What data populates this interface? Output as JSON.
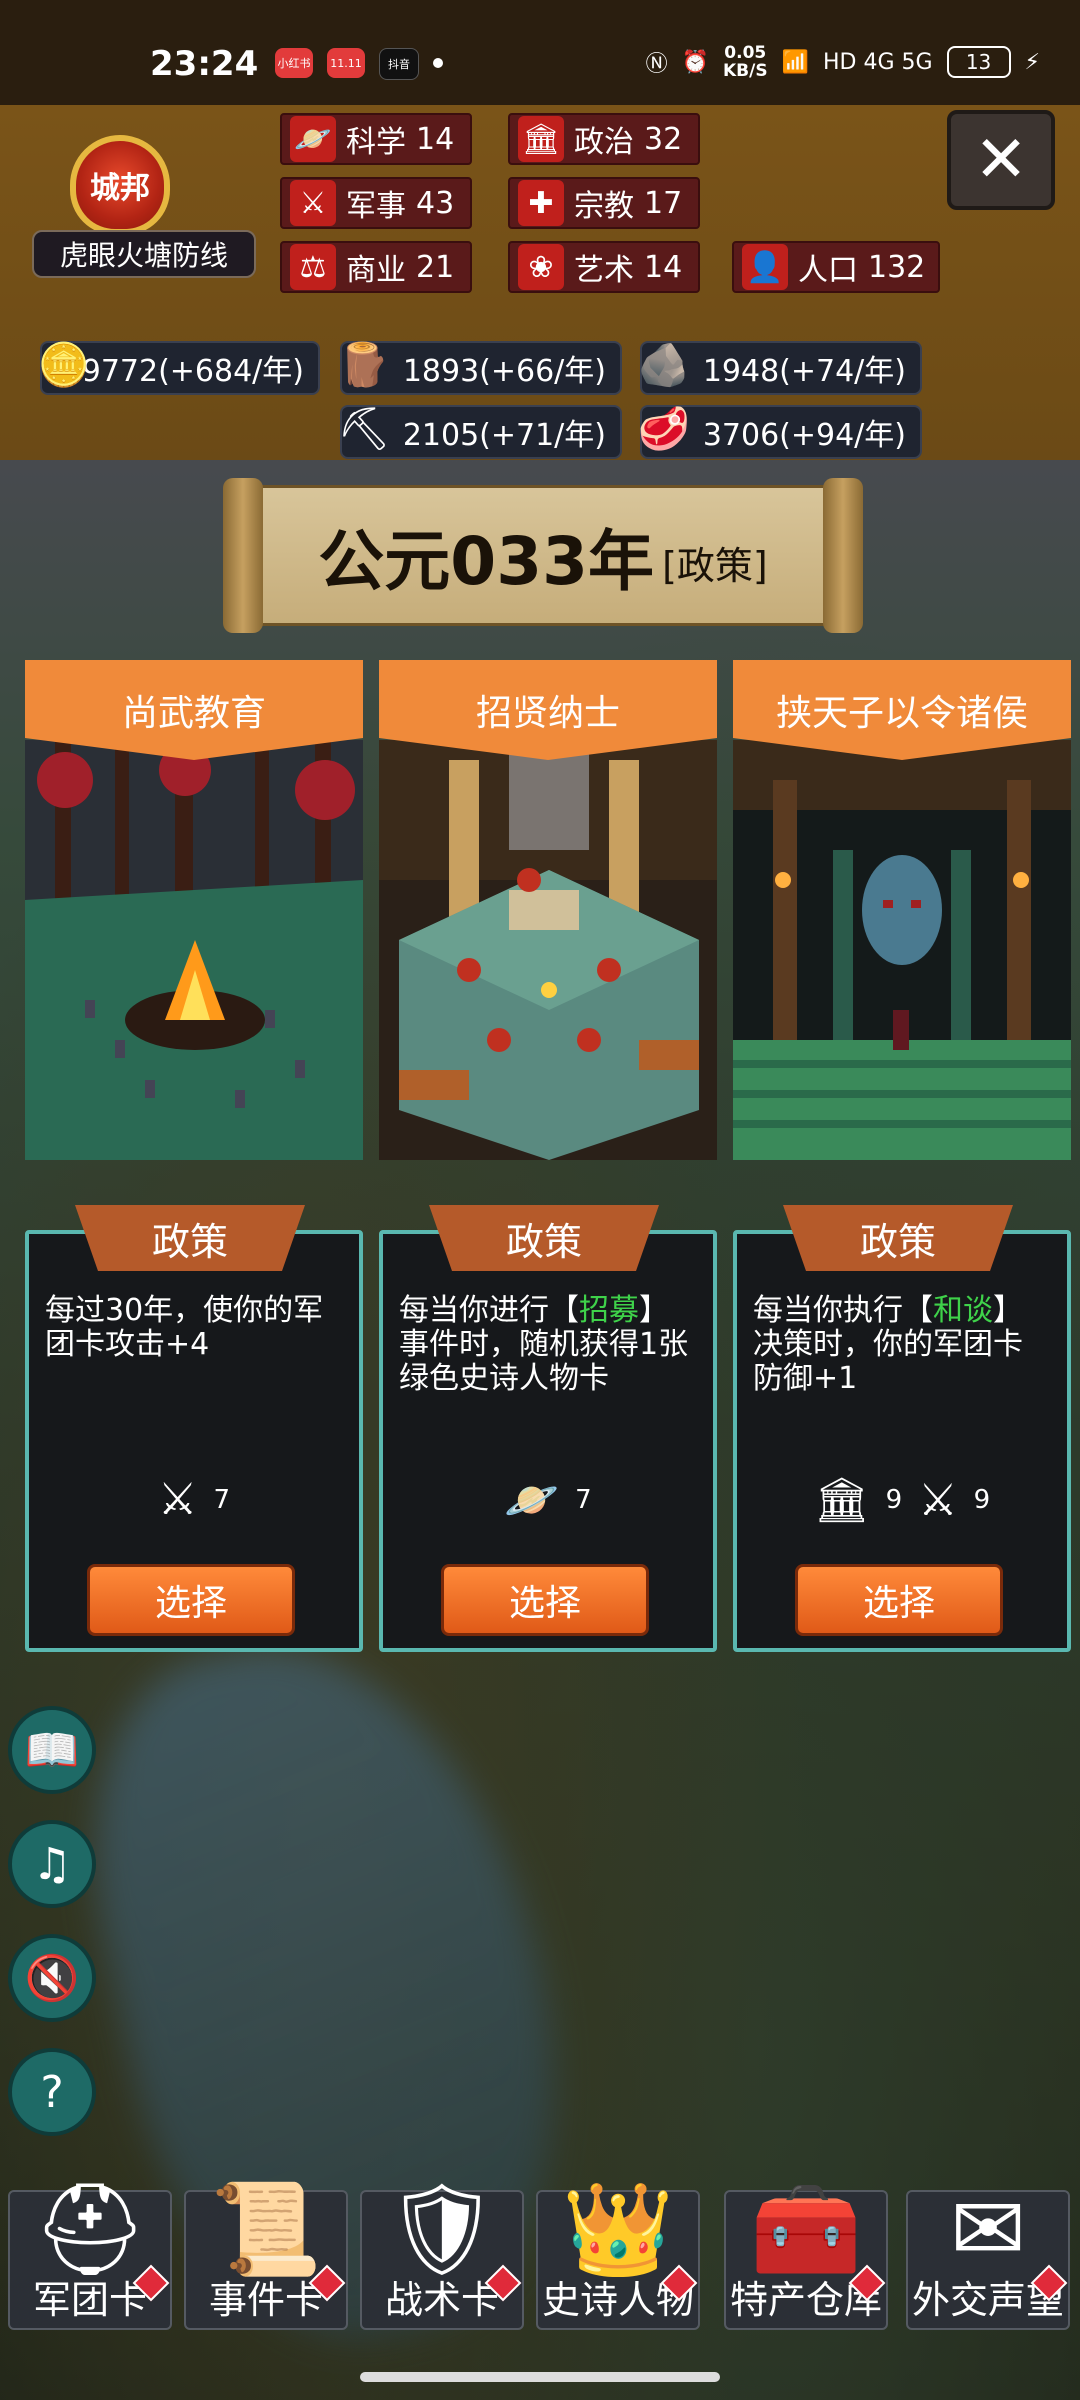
{
  "status_bar": {
    "time": "23:24",
    "apps": [
      "小红书",
      "11.11",
      "抖音"
    ],
    "speed_value": "0.05",
    "speed_unit": "KB/S",
    "network": "HD 4G 5G",
    "battery": "13"
  },
  "city": {
    "badge": "城邦",
    "name": "虎眼火塘防线"
  },
  "stats": [
    {
      "icon": "planet-icon",
      "label": "科学",
      "value": "14"
    },
    {
      "icon": "temple-icon",
      "label": "政治",
      "value": "32"
    },
    {
      "icon": "crossed-swords-icon",
      "label": "军事",
      "value": "43"
    },
    {
      "icon": "cross-icon",
      "label": "宗教",
      "value": "17"
    },
    {
      "icon": "scales-icon",
      "label": "商业",
      "value": "21"
    },
    {
      "icon": "lotus-icon",
      "label": "艺术",
      "value": "14"
    },
    {
      "icon": "person-icon",
      "label": "人口",
      "value": "132"
    }
  ],
  "resources": [
    {
      "icon": "gold-coins-icon",
      "text": "19772(+684/年)"
    },
    {
      "icon": "wood-logs-icon",
      "text": "1893(+66/年)"
    },
    {
      "icon": "stone-icon",
      "text": "1948(+74/年)"
    },
    {
      "icon": "iron-ore-icon",
      "text": "2105(+71/年)"
    },
    {
      "icon": "meat-icon",
      "text": "3706(+94/年)"
    }
  ],
  "year_scroll": {
    "year": "公元033年",
    "tag": "[政策]"
  },
  "cards": [
    {
      "title": "尚武教育",
      "type_label": "政策",
      "desc_parts": [
        "每过30年，使你的军团卡攻击+4",
        "",
        ""
      ],
      "requirements": [
        {
          "icon": "crossed-swords-icon",
          "value": "7"
        }
      ],
      "choose_label": "选择"
    },
    {
      "title": "招贤纳士",
      "type_label": "政策",
      "desc_parts": [
        "每当你进行【",
        "招募",
        "】事件时，随机获得1张绿色史诗人物卡"
      ],
      "requirements": [
        {
          "icon": "planet-icon",
          "value": "7"
        }
      ],
      "choose_label": "选择"
    },
    {
      "title": "挟天子以令诸侯",
      "type_label": "政策",
      "desc_parts": [
        "每当你执行【",
        "和谈",
        "】决策时，你的军团卡防御+1"
      ],
      "requirements": [
        {
          "icon": "temple-icon",
          "value": "9"
        },
        {
          "icon": "crossed-swords-icon",
          "value": "9"
        }
      ],
      "choose_label": "选择"
    }
  ],
  "side_buttons": [
    "card-book-icon",
    "music-off-icon",
    "sound-off-icon",
    "help-icon"
  ],
  "bottom_nav": [
    {
      "icon": "helmet-icon",
      "label": "军团卡"
    },
    {
      "icon": "scroll-icon",
      "label": "事件卡"
    },
    {
      "icon": "shield-swords-icon",
      "label": "战术卡"
    },
    {
      "icon": "crown-icon",
      "label": "史诗人物"
    },
    {
      "icon": "treasure-chest-icon",
      "label": "特产仓库"
    },
    {
      "icon": "envelope-icon",
      "label": "外交声望"
    }
  ]
}
